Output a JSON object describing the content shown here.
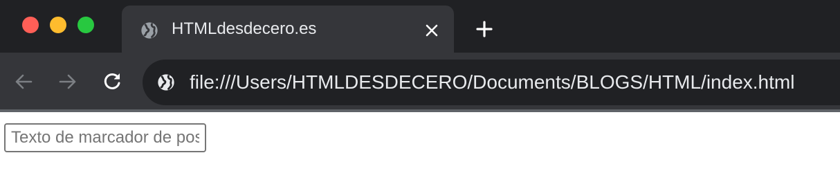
{
  "window": {
    "controls": [
      "close",
      "minimize",
      "maximize"
    ],
    "colors": {
      "close": "#ff5f57",
      "minimize": "#febc2e",
      "maximize": "#28c840"
    }
  },
  "tab": {
    "title": "HTMLdesdecero.es",
    "favicon": "globe-icon",
    "close_icon": "close-icon"
  },
  "new_tab_icon": "plus-icon",
  "toolbar": {
    "back_icon": "back-arrow-icon",
    "forward_icon": "forward-arrow-icon",
    "reload_icon": "reload-icon"
  },
  "address_bar": {
    "icon": "globe-icon",
    "url": "file:///Users/HTMLDESDECERO/Documents/BLOGS/HTML/index.html"
  },
  "page": {
    "input": {
      "value": "",
      "placeholder": "Texto de marcador de posición"
    }
  }
}
